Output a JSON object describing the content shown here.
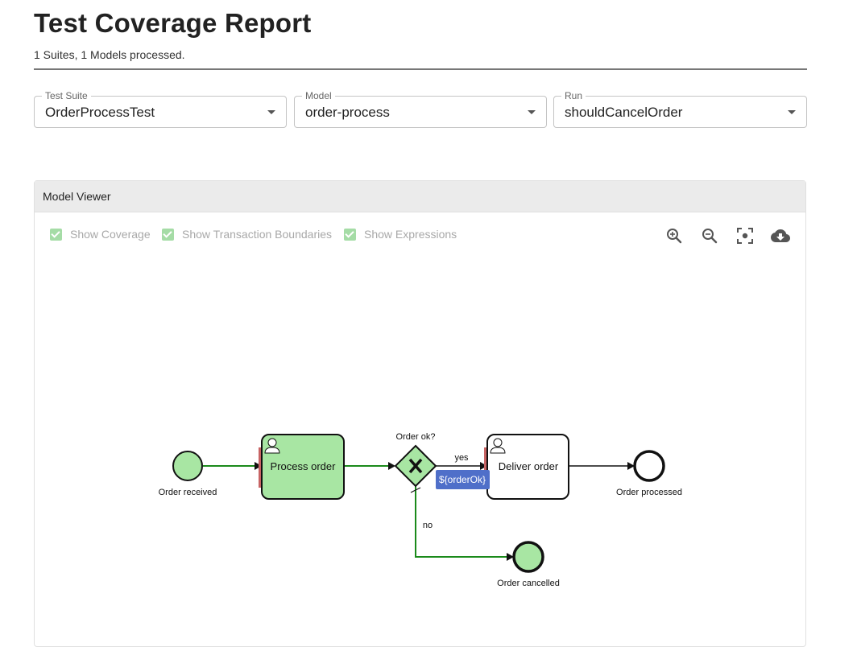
{
  "header": {
    "title": "Test Coverage Report",
    "subtitle": "1 Suites, 1 Models processed."
  },
  "selects": {
    "suite": {
      "label": "Test Suite",
      "value": "OrderProcessTest"
    },
    "model": {
      "label": "Model",
      "value": "order-process"
    },
    "run": {
      "label": "Run",
      "value": "shouldCancelOrder"
    }
  },
  "viewer": {
    "title": "Model Viewer",
    "checkboxes": {
      "coverage": {
        "label": "Show Coverage",
        "checked": true
      },
      "transactions": {
        "label": "Show Transaction Boundaries",
        "checked": true
      },
      "expressions": {
        "label": "Show Expressions",
        "checked": true
      }
    },
    "tools": [
      "zoom-in-icon",
      "zoom-out-icon",
      "reset-view-icon",
      "cloud-download-icon"
    ]
  },
  "diagram": {
    "start_event": "Order received",
    "task_process": "Process order",
    "gateway": "Order ok?",
    "flow_yes": "yes",
    "expression": "${orderOk}",
    "task_deliver": "Deliver order",
    "end_processed": "Order processed",
    "flow_no": "no",
    "end_cancelled": "Order cancelled"
  },
  "colors": {
    "covered_fill": "#a8e6a3",
    "covered_flow": "#1a8a1a",
    "transaction_boundary": "#c86464",
    "expression_bg": "#4f6fc9",
    "checkbox": "#a5dca6"
  }
}
